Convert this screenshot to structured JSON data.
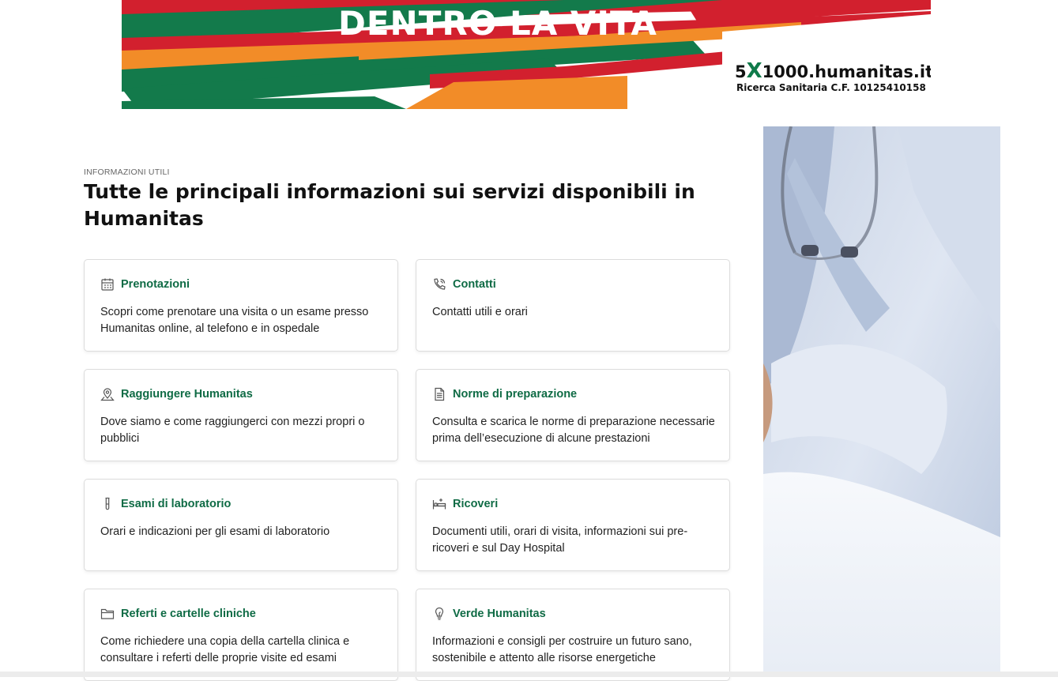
{
  "banner": {
    "title": "DENTRO LA VITA",
    "logo_five": "5",
    "logo_x": "X",
    "logo_domain": "1000.humanitas.it",
    "subtitle": "Ricerca Sanitaria C.F. 10125410158",
    "colors": {
      "green": "#137a4b",
      "red": "#d2202e",
      "orange": "#f28c28"
    }
  },
  "section": {
    "eyebrow": "INFORMAZIONI UTILI",
    "heading": "Tutte le principali informazioni sui servizi disponibili in Humanitas"
  },
  "cards": [
    {
      "icon": "calendar-icon",
      "title": "Prenotazioni",
      "description": "Scopri come prenotare una visita o un esame presso Humanitas online, al telefono e in ospedale"
    },
    {
      "icon": "phone-icon",
      "title": "Contatti",
      "description": "Contatti utili e orari"
    },
    {
      "icon": "location-pin-icon",
      "title": "Raggiungere Humanitas",
      "description": "Dove siamo e come raggiungerci con mezzi propri o pubblici"
    },
    {
      "icon": "document-icon",
      "title": "Norme di preparazione",
      "description": "Consulta e scarica le norme di preparazione necessarie prima dell’esecuzione di alcune prestazioni"
    },
    {
      "icon": "test-tube-icon",
      "title": "Esami di laboratorio",
      "description": "Orari e indicazioni per gli esami di laboratorio"
    },
    {
      "icon": "bed-icon",
      "title": "Ricoveri",
      "description": "Documenti utili, orari di visita, informazioni sui pre-ricoveri e sul Day Hospital"
    },
    {
      "icon": "folder-icon",
      "title": "Referti e cartelle cliniche",
      "description": "Come richiedere una copia della cartella clinica e consultare i referti delle proprie visite ed esami"
    },
    {
      "icon": "lightbulb-icon",
      "title": "Verde Humanitas",
      "description": "Informazioni e consigli per costruire un futuro sano, sostenibile e attento alle risorse energetiche"
    }
  ],
  "theme": {
    "accent": "#0f6b45",
    "card_border": "#dcdcdc"
  }
}
